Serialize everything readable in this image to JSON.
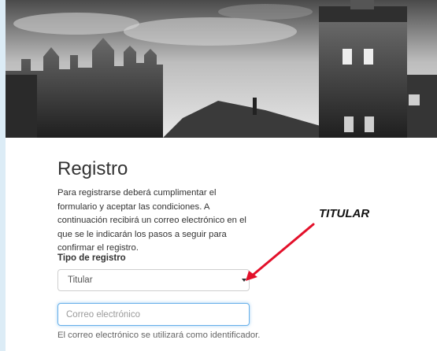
{
  "page": {
    "title": "Registro",
    "intro": "Para registrarse deberá cumplimentar el formulario y aceptar las condiciones. A continuación recibirá un correo electrónico en el que se le indicarán los pasos a seguir para confirmar el registro."
  },
  "form": {
    "tipo_label": "Tipo de registro",
    "tipo_value": "Titular",
    "email_placeholder": "Correo electrónico",
    "email_help": "El correo electrónico se utilizará como identificador."
  },
  "annotation": {
    "text": "TITULAR",
    "arrow_color": "#e3102a"
  },
  "colors": {
    "page_bg": "#dcecf6",
    "focus_border": "#66afe9"
  },
  "icons": {
    "select_caret": "chevron-down-icon"
  }
}
